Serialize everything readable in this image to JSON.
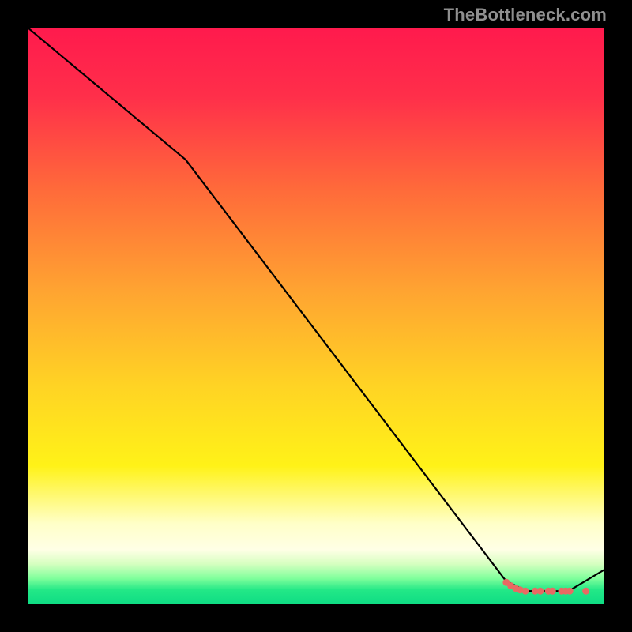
{
  "watermark": "TheBottleneck.com",
  "chart_data": {
    "type": "line",
    "title": "",
    "xlabel": "",
    "ylabel": "",
    "xlim": [
      0,
      100
    ],
    "ylim": [
      0,
      100
    ],
    "grid": false,
    "legend": false,
    "gradient_stops": [
      {
        "offset": 0.0,
        "color": "#ff1a4d"
      },
      {
        "offset": 0.12,
        "color": "#ff2f4a"
      },
      {
        "offset": 0.28,
        "color": "#ff6a3a"
      },
      {
        "offset": 0.46,
        "color": "#ffa531"
      },
      {
        "offset": 0.62,
        "color": "#ffd324"
      },
      {
        "offset": 0.76,
        "color": "#fff218"
      },
      {
        "offset": 0.86,
        "color": "#ffffc8"
      },
      {
        "offset": 0.905,
        "color": "#ffffe6"
      },
      {
        "offset": 0.93,
        "color": "#d6ffc0"
      },
      {
        "offset": 0.955,
        "color": "#80ff9c"
      },
      {
        "offset": 0.975,
        "color": "#23e887"
      },
      {
        "offset": 1.0,
        "color": "#0edc84"
      }
    ],
    "series": [
      {
        "name": "bottleneck-curve",
        "color": "#000000",
        "points": [
          {
            "x": 0.0,
            "y": 100.0
          },
          {
            "x": 27.4,
            "y": 77.1
          },
          {
            "x": 82.9,
            "y": 4.1
          },
          {
            "x": 86.5,
            "y": 2.3
          },
          {
            "x": 93.8,
            "y": 2.3
          },
          {
            "x": 100.0,
            "y": 6.0
          }
        ]
      }
    ],
    "markers": {
      "name": "bottleneck-markers",
      "color": "#e86a63",
      "points": [
        {
          "x": 83.0,
          "y": 3.8
        },
        {
          "x": 83.8,
          "y": 3.2
        },
        {
          "x": 84.6,
          "y": 2.8
        },
        {
          "x": 85.4,
          "y": 2.5
        },
        {
          "x": 86.3,
          "y": 2.3
        },
        {
          "x": 88.0,
          "y": 2.3
        },
        {
          "x": 88.9,
          "y": 2.3
        },
        {
          "x": 90.3,
          "y": 2.3
        },
        {
          "x": 91.0,
          "y": 2.3
        },
        {
          "x": 92.6,
          "y": 2.3
        },
        {
          "x": 93.3,
          "y": 2.3
        },
        {
          "x": 94.0,
          "y": 2.3
        },
        {
          "x": 96.8,
          "y": 2.3
        }
      ]
    }
  }
}
